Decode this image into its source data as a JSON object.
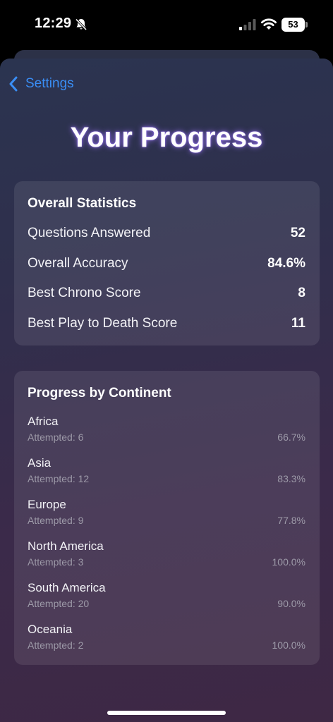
{
  "status_bar": {
    "time": "12:29",
    "battery": "53"
  },
  "nav": {
    "back_label": "Settings"
  },
  "page": {
    "title": "Your Progress"
  },
  "overall_statistics": {
    "title": "Overall Statistics",
    "rows": [
      {
        "label": "Questions Answered",
        "value": "52"
      },
      {
        "label": "Overall Accuracy",
        "value": "84.6%"
      },
      {
        "label": "Best Chrono Score",
        "value": "8"
      },
      {
        "label": "Best Play to Death Score",
        "value": "11"
      }
    ]
  },
  "continents": {
    "title": "Progress by Continent",
    "items": [
      {
        "name": "Africa",
        "attempted": "Attempted: 6",
        "accuracy": "66.7%"
      },
      {
        "name": "Asia",
        "attempted": "Attempted: 12",
        "accuracy": "83.3%"
      },
      {
        "name": "Europe",
        "attempted": "Attempted: 9",
        "accuracy": "77.8%"
      },
      {
        "name": "North America",
        "attempted": "Attempted: 3",
        "accuracy": "100.0%"
      },
      {
        "name": "South America",
        "attempted": "Attempted: 20",
        "accuracy": "90.0%"
      },
      {
        "name": "Oceania",
        "attempted": "Attempted: 2",
        "accuracy": "100.0%"
      }
    ]
  },
  "colors": {
    "accent": "#3a8ef5",
    "title_glow": "#a078ff",
    "secondary_text": "#9d9aa8"
  },
  "icons": [
    "bell-slash-icon",
    "cellular-signal-icon",
    "wifi-icon",
    "battery-icon",
    "chevron-left-icon"
  ]
}
